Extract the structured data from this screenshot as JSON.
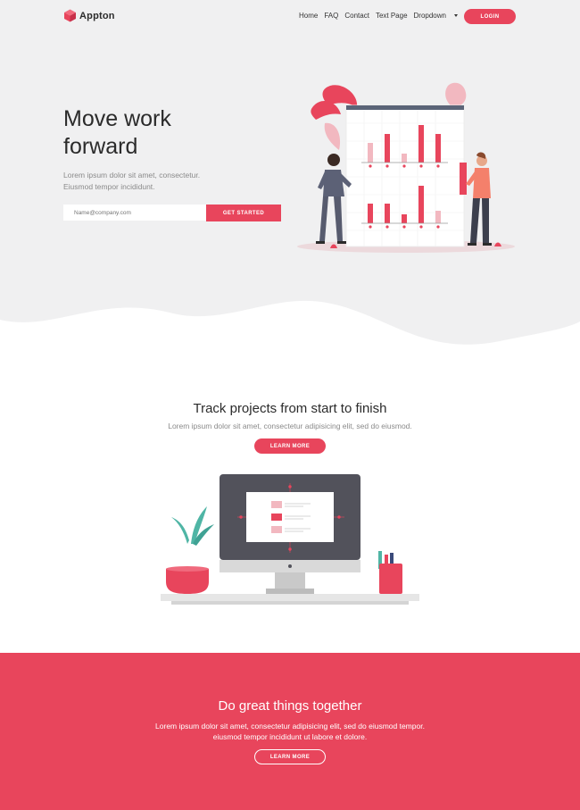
{
  "brand": {
    "name": "Appton"
  },
  "nav": {
    "items": [
      "Home",
      "FAQ",
      "Contact",
      "Text Page"
    ],
    "dropdown_label": "Dropdown",
    "login_label": "LOGIN"
  },
  "hero": {
    "title_line1": "Move work",
    "title_line2": "forward",
    "text_line1": "Lorem ipsum dolor sit amet, consectetur.",
    "text_line2": "Eiusmod tempor incididunt.",
    "input_placeholder": "Name@company.com",
    "button_label": "GET STARTED"
  },
  "feature": {
    "title": "Track projects from start to finish",
    "text": "Lorem ipsum dolor sit amet, consectetur adipisicing elit, sed do eiusmod.",
    "button_label": "LEARN MORE"
  },
  "cta": {
    "title": "Do great things together",
    "text_line1": "Lorem ipsum dolor sit amet, consectetur adipisicing elit, sed do eiusmod tempor.",
    "text_line2": "eiusmod tempor incididunt ut labore et dolore.",
    "button_label": "LEARN MORE"
  },
  "colors": {
    "accent": "#e8455c",
    "hero_bg": "#f0f0f1",
    "dark_text": "#2b2b2b",
    "muted_text": "#8a8a8a"
  },
  "icons": {
    "logo": "cube-logo-icon",
    "dropdown": "caret-down-icon"
  }
}
